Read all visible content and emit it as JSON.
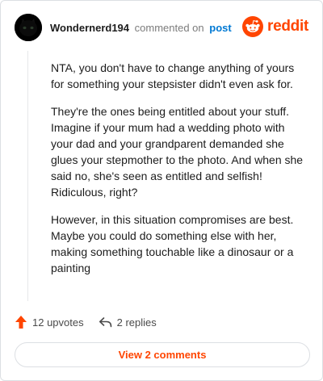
{
  "header": {
    "username": "Wondernerd194",
    "commented_text": "commented on",
    "post_link": "post",
    "brand": "reddit",
    "avatar_icon": "black-cat-avatar",
    "brand_icon": "reddit-snoo-icon",
    "brand_color": "#ff4500"
  },
  "comment": {
    "paragraphs": [
      "NTA, you don't have to change anything of yours for something your stepsister didn't even ask for.",
      "They're the ones being entitled about your stuff. Imagine if your mum had a wedding photo with your dad and your grandparent demanded she glues your stepmother to the photo. And when she said no, she's seen as entitled and selfish! Ridiculous, right?",
      "However, in this situation compromises are best. Maybe you could do something else with her, making something touchable like a dinosaur or a painting"
    ]
  },
  "actions": {
    "upvotes": "12 upvotes",
    "replies": "2 replies",
    "upvote_icon": "upvote-arrow-icon",
    "reply_icon": "reply-arrow-icon",
    "upvote_color": "#ff4500"
  },
  "footer": {
    "view_comments": "View 2 comments"
  }
}
